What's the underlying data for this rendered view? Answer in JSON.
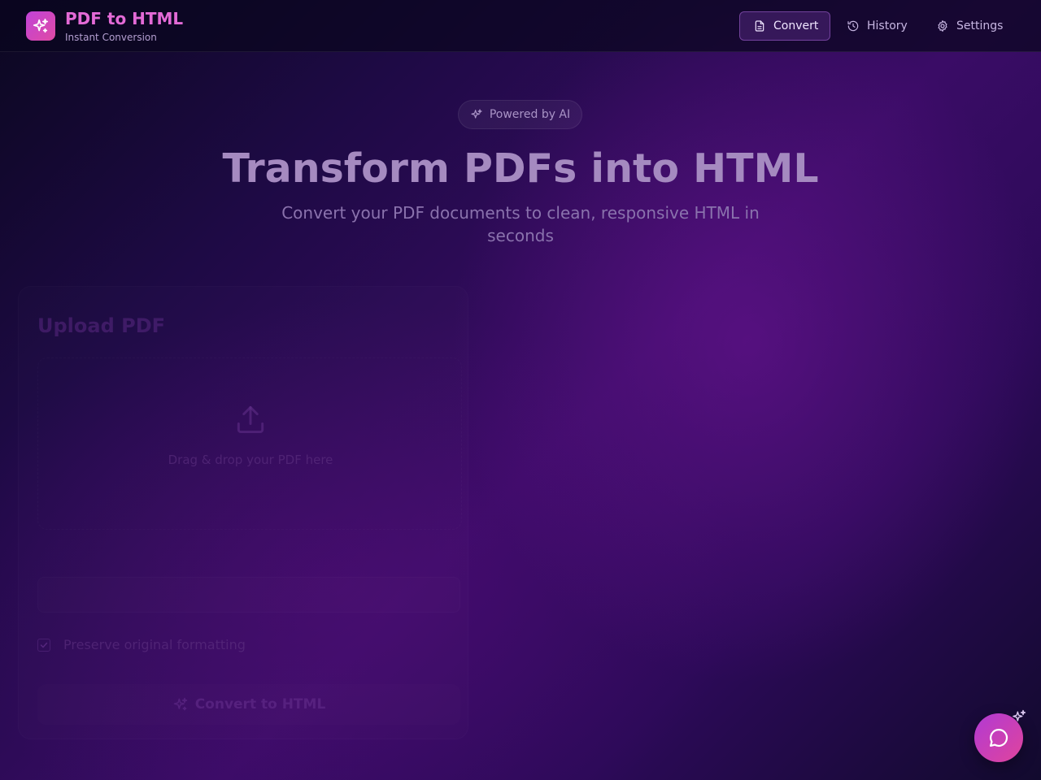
{
  "header": {
    "app_title": "PDF to HTML",
    "app_subtitle": "Instant Conversion",
    "logo_icon": "sparkles-icon",
    "nav": [
      {
        "label": "Convert",
        "icon": "file-text-icon",
        "active": true
      },
      {
        "label": "History",
        "icon": "history-icon",
        "active": false
      },
      {
        "label": "Settings",
        "icon": "gear-icon",
        "active": false
      }
    ]
  },
  "hero": {
    "badge": "Powered by AI",
    "title": "Transform PDFs into HTML",
    "subtitle": "Convert your PDF documents to clean, responsive HTML in seconds"
  },
  "upload": {
    "card_title": "Upload PDF",
    "dropzone_text": "Drag & drop your PDF here",
    "checkbox_label": "Preserve original formatting",
    "checkbox_checked": true,
    "convert_label": "Convert to HTML"
  },
  "colors": {
    "accent": "#c043d8",
    "accent_pink": "#e04aa4",
    "brand_text": "#e36ad6"
  }
}
